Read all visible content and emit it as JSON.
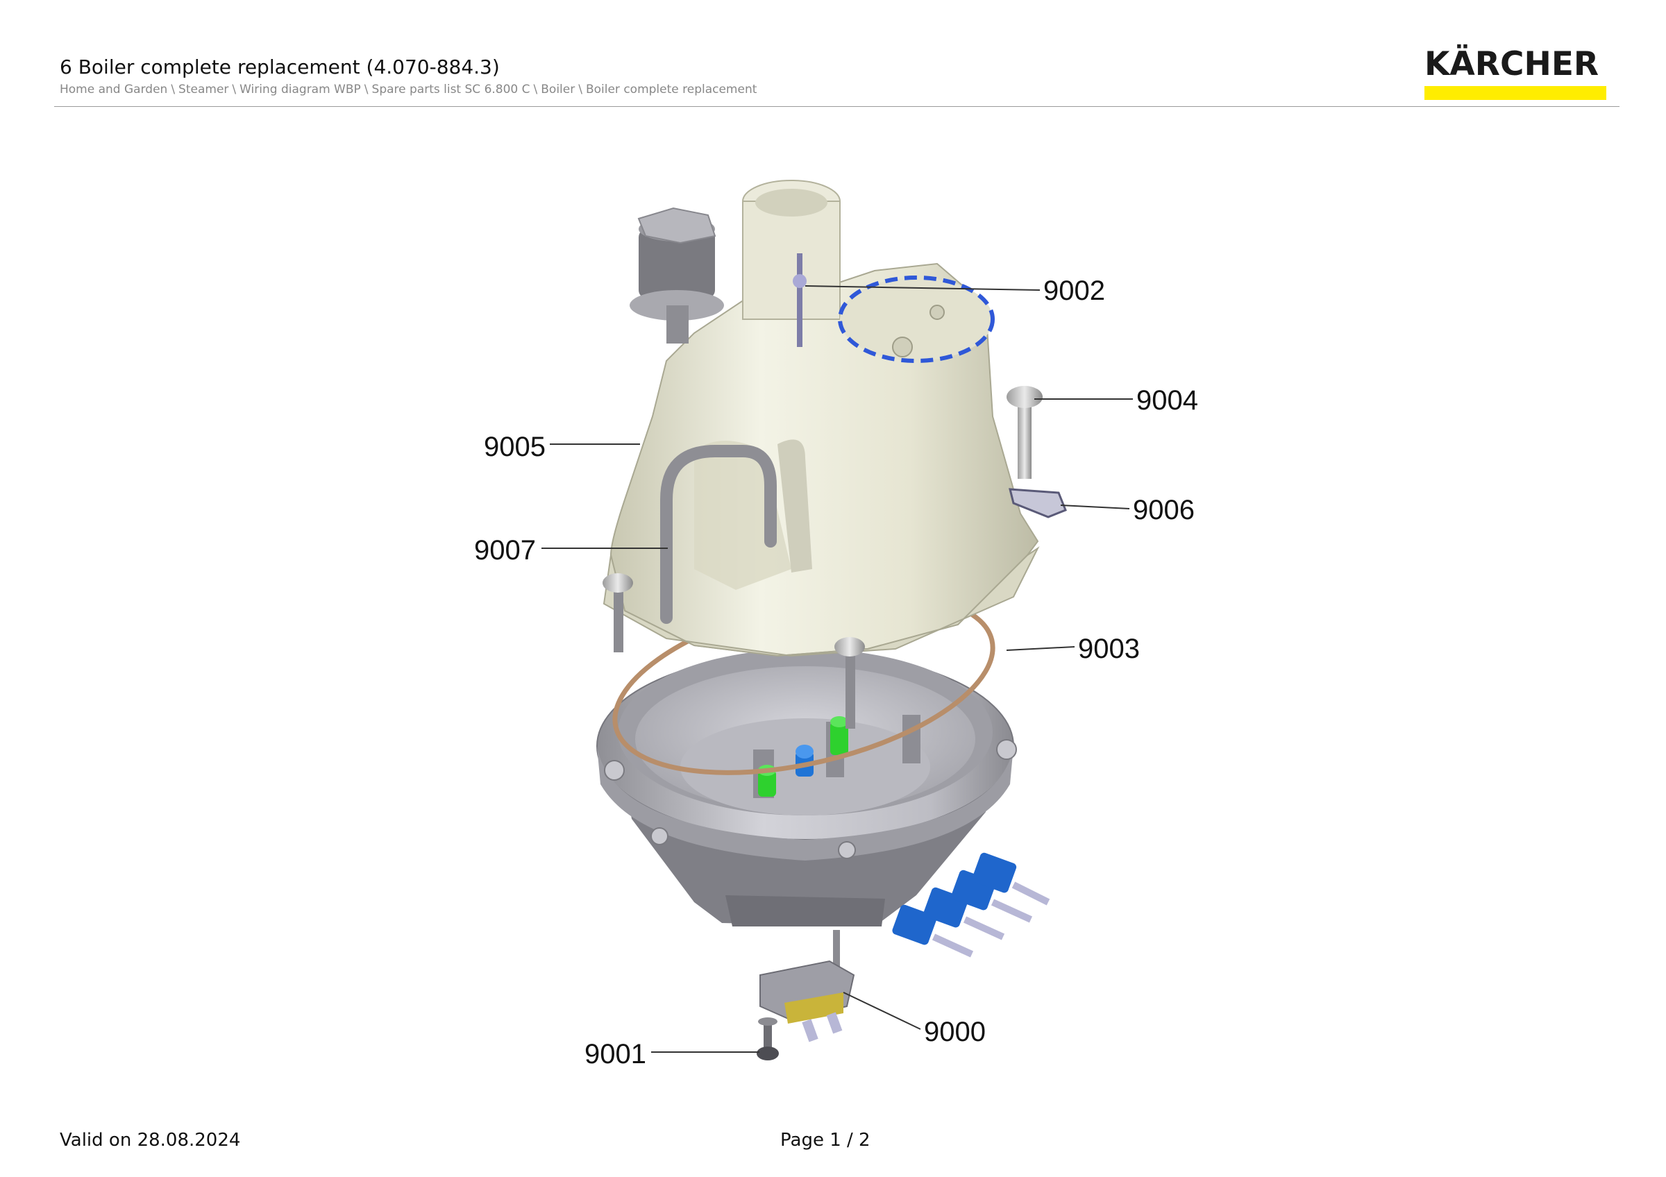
{
  "header": {
    "title": "6 Boiler complete replacement (4.070-884.3)",
    "breadcrumb": [
      "Home and Garden",
      "Steamer",
      "Wiring diagram WBP",
      "Spare parts list SC 6.800 C",
      "Boiler",
      "Boiler complete replacement"
    ],
    "breadcrumb_separator": "\\",
    "logo_text": "KÄRCHER",
    "logo_color": "#ffed00"
  },
  "diagram": {
    "callouts": [
      "9000",
      "9001",
      "9002",
      "9003",
      "9004",
      "9005",
      "9006",
      "9007"
    ]
  },
  "footer": {
    "valid": "Valid on 28.08.2024",
    "page": "Page 1 / 2"
  }
}
